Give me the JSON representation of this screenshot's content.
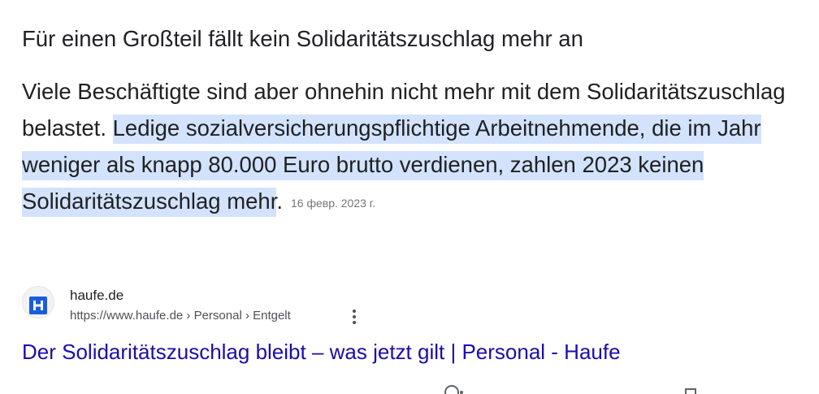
{
  "snippet": {
    "heading": "Für einen Großteil fällt kein Solidaritätszuschlag mehr an",
    "body_plain": "Viele Beschäftigte sind aber ohnehin nicht mehr mit dem Solidaritätszuschlag belastet.",
    "body_highlighted": "Ledige sozialversicherungspflichtige Arbeitnehmende, die im Jahr weniger als knapp 80.000 Euro brutto verdienen, zahlen 2023 keinen Solidaritätszuschlag mehr",
    "body_end": ".",
    "date": "16 февр. 2023 г.",
    "highlight_color": "#d3e3fd"
  },
  "source": {
    "favicon_icon": "haufe-h-icon",
    "favicon_color": "#1a5cdb",
    "site_name": "haufe.de",
    "url_breadcrumb": "https://www.haufe.de › Personal › Entgelt",
    "menu_icon": "more-vert-icon"
  },
  "result": {
    "title": "Der Solidaritätszuschlag bleibt – was jetzt gilt | Personal - Haufe",
    "link_color": "#1a0dab"
  },
  "footer": {
    "icons": [
      "help-icon",
      "feedback-icon"
    ]
  }
}
